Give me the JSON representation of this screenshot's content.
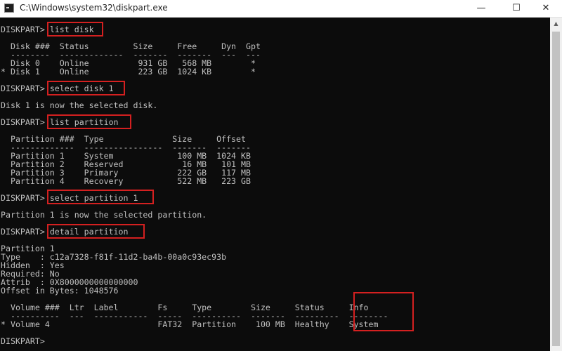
{
  "window": {
    "title": "C:\\Windows\\system32\\diskpart.exe",
    "minimize_label": "—",
    "maximize_label": "☐",
    "close_label": "✕"
  },
  "prompt": "DISKPART>",
  "console": {
    "cmd1": "list disk",
    "disk_header": "  Disk ###  Status         Size     Free     Dyn  Gpt",
    "disk_sep": "  --------  -------------  -------  -------  ---  ---",
    "disk_row0": "  Disk 0    Online          931 GB   568 MB        *",
    "disk_row1": "* Disk 1    Online          223 GB  1024 KB        *",
    "cmd2": "select disk 1",
    "msg2": "Disk 1 is now the selected disk.",
    "cmd3": "list partition",
    "part_header": "  Partition ###  Type              Size     Offset",
    "part_sep": "  -------------  ----------------  -------  -------",
    "part_row1": "  Partition 1    System             100 MB  1024 KB",
    "part_row2": "  Partition 2    Reserved            16 MB   101 MB",
    "part_row3": "  Partition 3    Primary            222 GB   117 MB",
    "part_row4": "  Partition 4    Recovery           522 MB   223 GB",
    "cmd4": "select partition 1",
    "msg4": "Partition 1 is now the selected partition.",
    "cmd5": "detail partition",
    "detail_title": "Partition 1",
    "detail_type": "Type    : c12a7328-f81f-11d2-ba4b-00a0c93ec93b",
    "detail_hidden": "Hidden  : Yes",
    "detail_required": "Required: No",
    "detail_attrib": "Attrib  : 0X8000000000000000",
    "detail_offset": "Offset in Bytes: 1048576",
    "vol_header": "  Volume ###  Ltr  Label        Fs     Type        Size     Status     Info",
    "vol_sep": "  ----------  ---  -----------  -----  ----------  -------  ---------  --------",
    "vol_row": "* Volume 4                      FAT32  Partition    100 MB  Healthy    System"
  }
}
